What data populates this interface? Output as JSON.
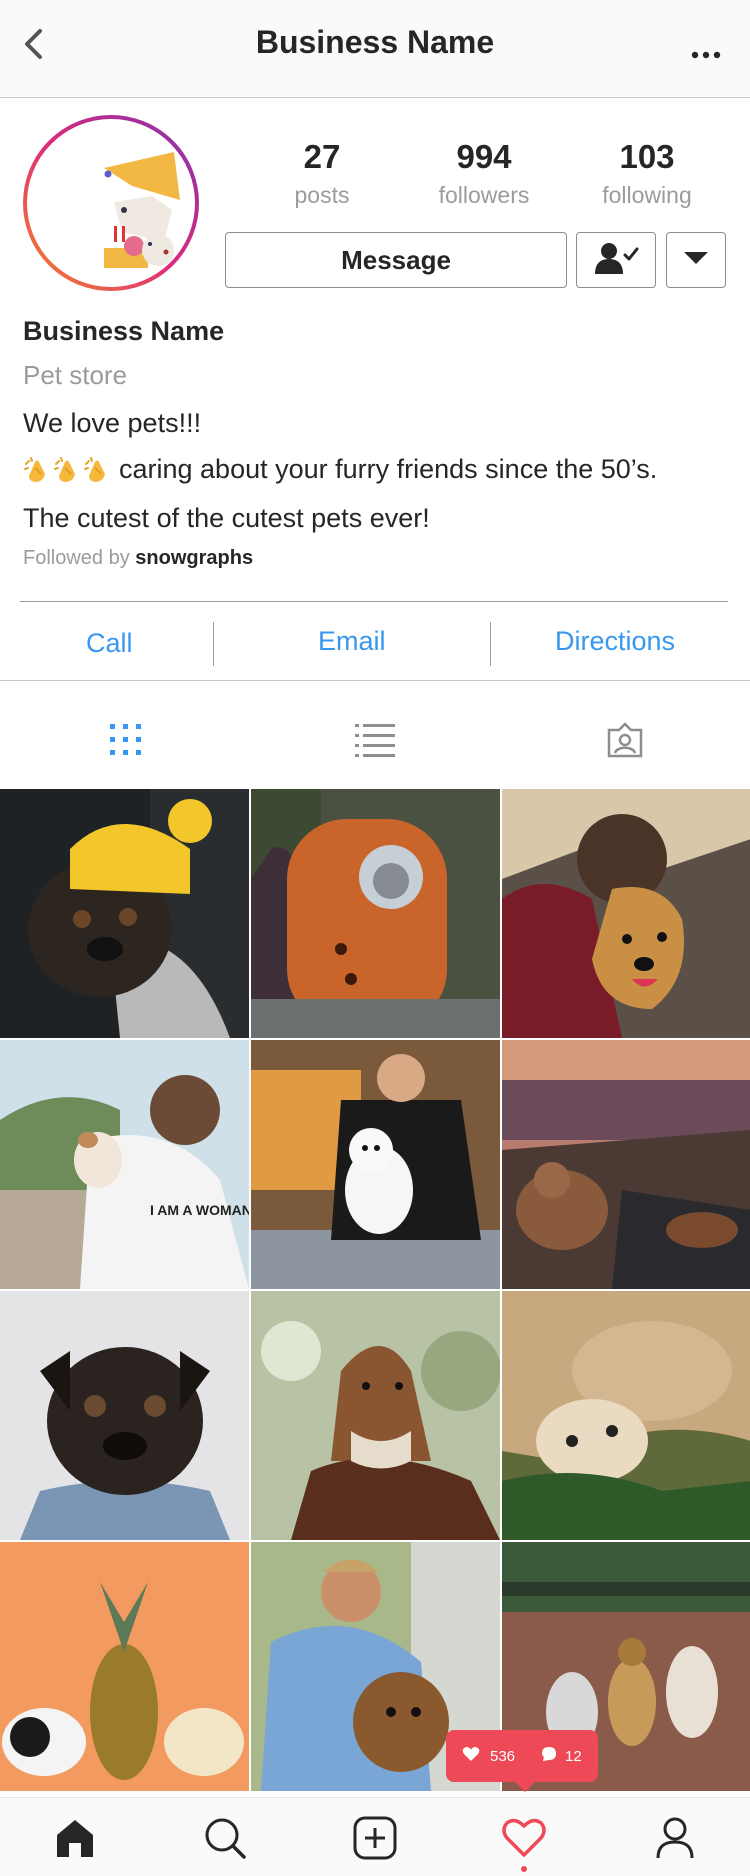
{
  "header": {
    "title": "Business Name",
    "back_icon": "chevron-left-icon",
    "more_icon": "more-horizontal-icon"
  },
  "profile": {
    "stats": [
      {
        "value": "27",
        "label": "posts"
      },
      {
        "value": "994",
        "label": "followers"
      },
      {
        "value": "103",
        "label": "following"
      }
    ],
    "message_label": "Message",
    "follow_icon": "person-check-icon",
    "dropdown_icon": "caret-down-icon"
  },
  "bio": {
    "name": "Business Name",
    "category": "Pet store",
    "line1": "We love pets!!!",
    "line2": "caring about your furry friends since the 50’s.",
    "line2_emoji": "clapping-hands-icon",
    "line3": "The cutest of the cutest pets ever!",
    "followed_prefix": "Followed by",
    "followed_user": "snowgraphs"
  },
  "actions": {
    "call": "Call",
    "email": "Email",
    "directions": "Directions"
  },
  "tabs": [
    {
      "name": "grid-view-icon",
      "active": true
    },
    {
      "name": "list-view-icon",
      "active": false
    },
    {
      "name": "tagged-icon",
      "active": false
    }
  ],
  "posts": [
    "pug-in-yellow-beanie",
    "cat-in-orange-backpack",
    "man-hugging-golden-dog",
    "woman-holding-small-dog",
    "man-grooming-white-spitz",
    "dogs-on-rocks-at-sunset",
    "black-pug-in-denim",
    "saluki-dog-portrait",
    "cat-and-dog-cuddling",
    "guinea-pigs-with-pineapple",
    "man-with-boxer-dog",
    "dog-walker-with-pack"
  ],
  "notification": {
    "likes": "536",
    "comments": "12"
  },
  "bottom_nav": [
    "home-icon",
    "search-icon",
    "add-post-icon",
    "activity-heart-icon",
    "profile-icon"
  ],
  "colors": {
    "accent": "#3897f0",
    "notification": "#ed4956",
    "text": "#262626",
    "muted": "#9b9b9b"
  }
}
